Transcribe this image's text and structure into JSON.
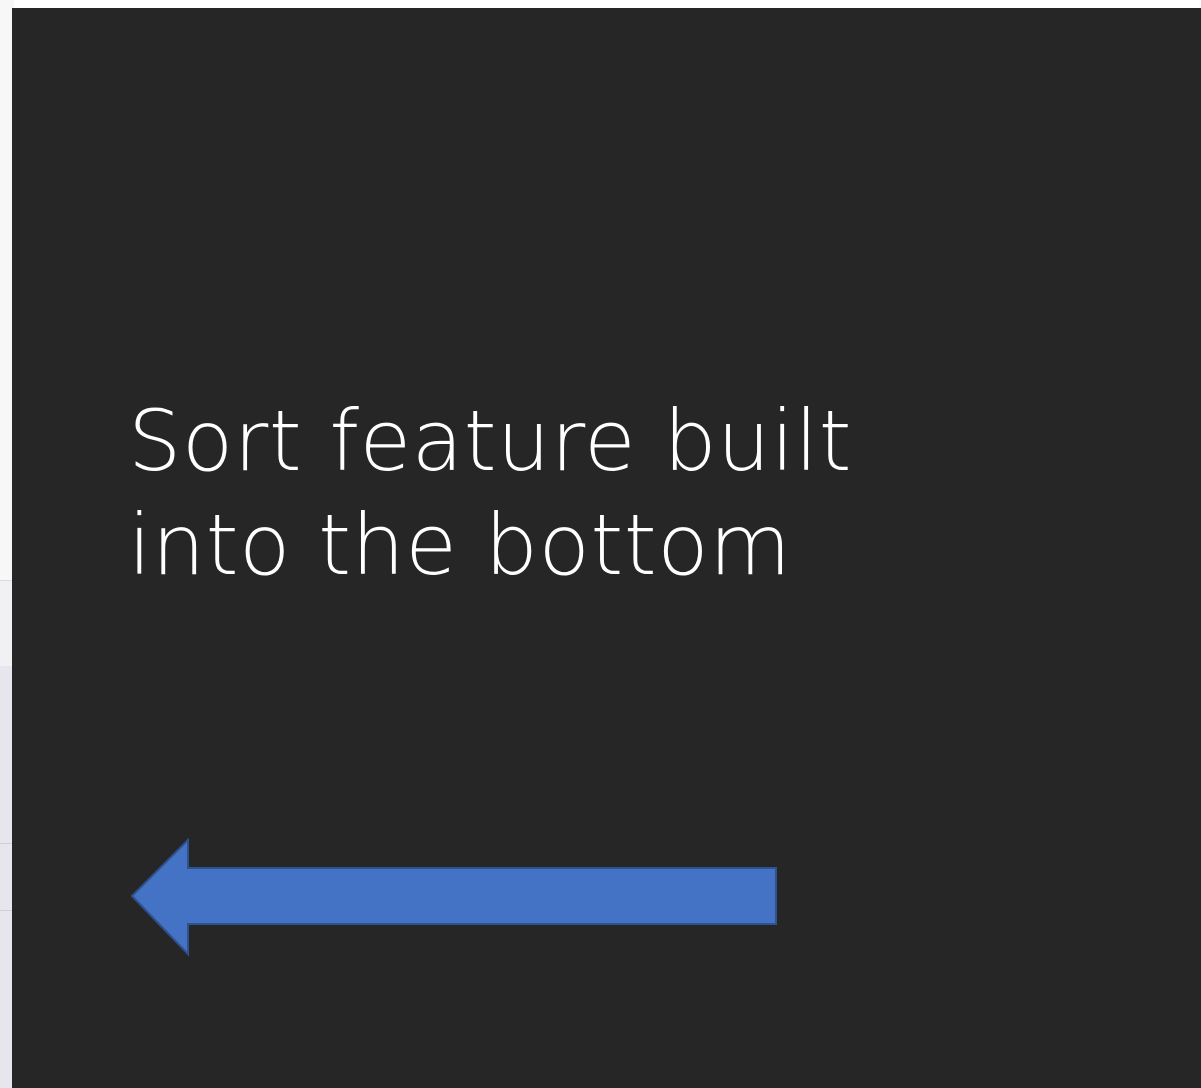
{
  "slide": {
    "background": "#262626",
    "text_color": "#ffffff",
    "text_lines": [
      "Sort feature built",
      "into the bottom"
    ],
    "arrow": {
      "icon": "left-arrow-icon",
      "direction": "left",
      "fill": "#4472C4",
      "stroke": "#2F528F"
    }
  }
}
